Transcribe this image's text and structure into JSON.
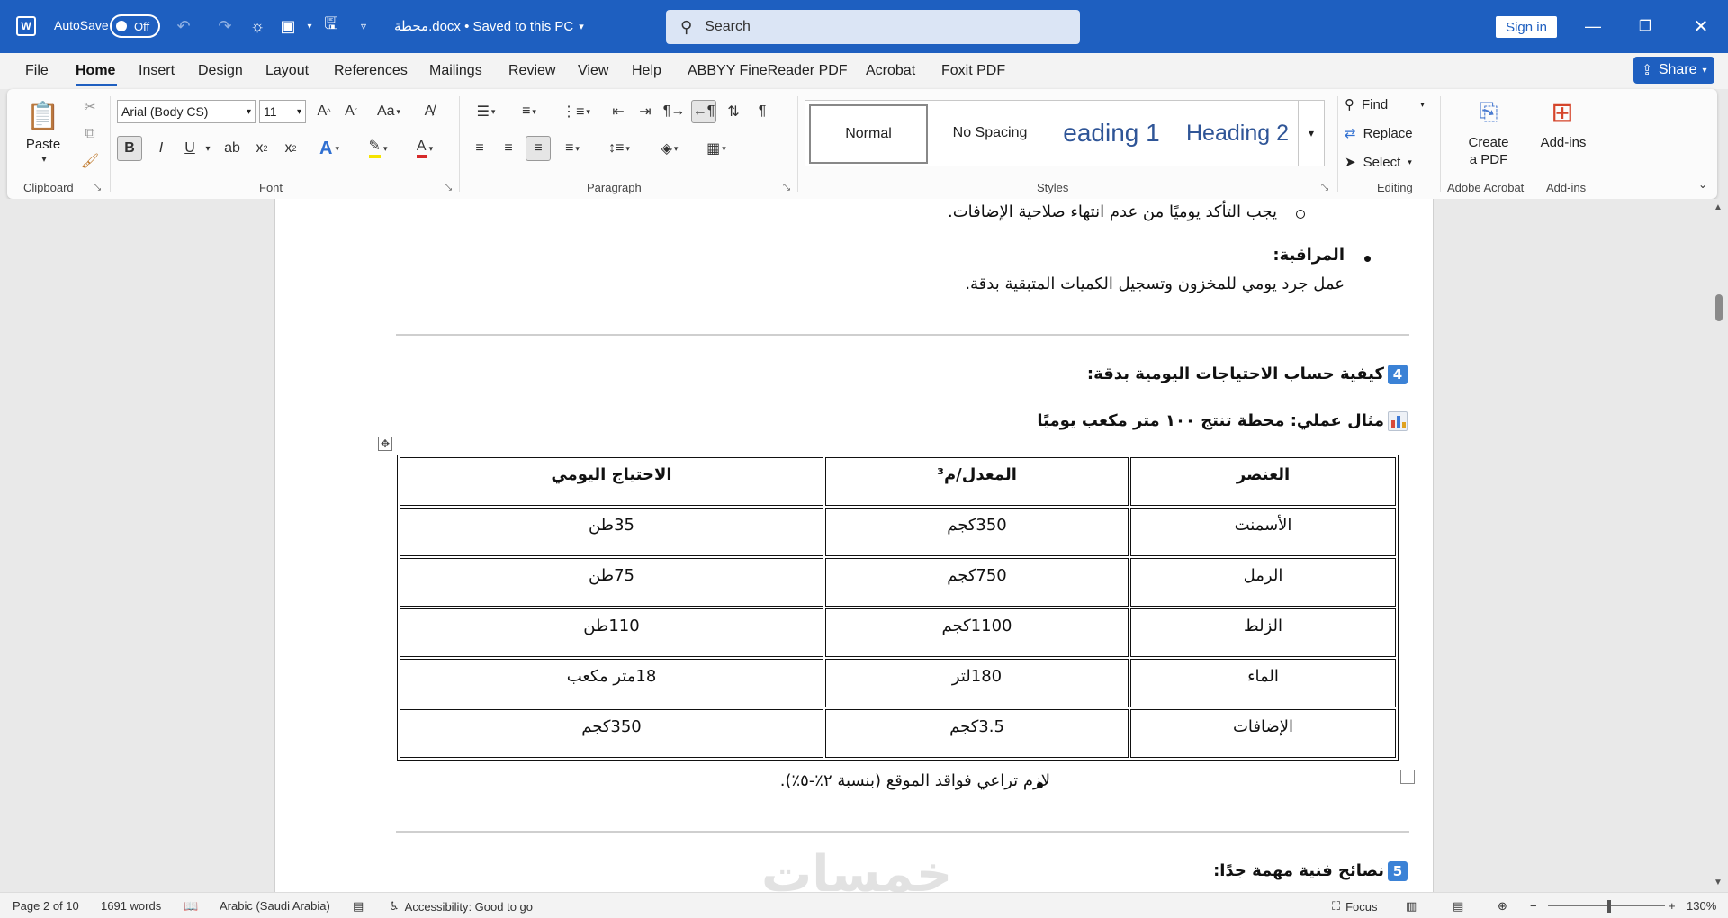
{
  "titlebar": {
    "app_logo": "W",
    "autosave_label": "AutoSave",
    "autosave_state": "Off",
    "doc_title": "محطة.docx • Saved to this PC",
    "search_placeholder": "Search",
    "signin_label": "Sign in"
  },
  "menu": {
    "items": [
      "File",
      "Home",
      "Insert",
      "Design",
      "Layout",
      "References",
      "Mailings",
      "Review",
      "View",
      "Help",
      "ABBYY FineReader PDF",
      "Acrobat",
      "Foxit PDF"
    ],
    "active": "Home",
    "share_label": "Share"
  },
  "ribbon": {
    "clipboard": {
      "paste_label": "Paste",
      "group_label": "Clipboard"
    },
    "font": {
      "font_name": "Arial (Body CS)",
      "font_size": "11",
      "group_label": "Font"
    },
    "paragraph": {
      "group_label": "Paragraph"
    },
    "styles": {
      "normal": "Normal",
      "no_spacing": "No Spacing",
      "heading1": "eading 1",
      "heading2": "Heading 2",
      "group_label": "Styles"
    },
    "editing": {
      "find": "Find",
      "replace": "Replace",
      "select": "Select",
      "group_label": "Editing"
    },
    "acrobat": {
      "create_pdf_line1": "Create",
      "create_pdf_line2": "a PDF",
      "group_label": "Adobe Acrobat"
    },
    "addins": {
      "label": "Add-ins",
      "group_label": "Add-ins"
    }
  },
  "document": {
    "sub_bullet_1": "يجب التأكد يوميًا من عدم انتهاء صلاحية الإضافات.",
    "monitoring_title": "المراقبة:",
    "monitoring_text": "عمل جرد يومي للمخزون وتسجيل الكميات المتبقية بدقة.",
    "section4_num": "4",
    "section4_title": "كيفية حساب الاحتياجات اليومية بدقة:",
    "example_title": "مثال عملي: محطة تنتج ١٠٠ متر مكعب يوميًا",
    "table": {
      "headers": [
        "العنصر",
        "المعدل/م³",
        "الاحتياج اليومي"
      ],
      "rows": [
        [
          "الأسمنت",
          "350كجم",
          "35طن"
        ],
        [
          "الرمل",
          "750كجم",
          "75طن"
        ],
        [
          "الزلط",
          "1100كجم",
          "110طن"
        ],
        [
          "الماء",
          "180لتر",
          "18متر مكعب"
        ],
        [
          "الإضافات",
          "3.5كجم",
          "350كجم"
        ]
      ]
    },
    "waste_note": "لازم تراعي فواقد الموقع (بنسبة ٢٪-٥٪).",
    "section5_num": "5",
    "section5_title": "نصائح فنية مهمة جدًا:",
    "watermark": "خمسات"
  },
  "status": {
    "page": "Page 2 of 10",
    "words": "1691 words",
    "language": "Arabic (Saudi Arabia)",
    "accessibility": "Accessibility: Good to go",
    "focus": "Focus",
    "zoom": "130%"
  },
  "colors": {
    "brand": "#1e5fc0",
    "heading": "#2f5597",
    "badge": "#3b82d6"
  }
}
